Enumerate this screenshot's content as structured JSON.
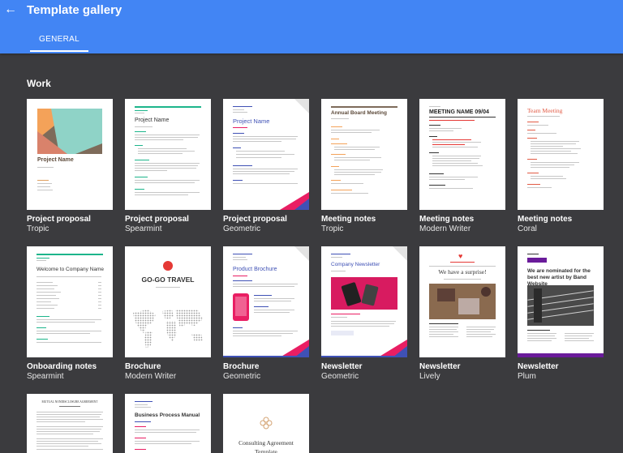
{
  "header": {
    "back_icon": "arrow-left-icon",
    "title": "Template gallery",
    "tab": "GENERAL",
    "accent": "#4285f4"
  },
  "section": {
    "title": "Work"
  },
  "templates": [
    {
      "name": "Project proposal",
      "style": "Tropic",
      "thumb_title": "Project Name"
    },
    {
      "name": "Project proposal",
      "style": "Spearmint",
      "thumb_title": "Project Name"
    },
    {
      "name": "Project proposal",
      "style": "Geometric",
      "thumb_title": "Project Name"
    },
    {
      "name": "Meeting notes",
      "style": "Tropic",
      "thumb_title": "Annual Board Meeting"
    },
    {
      "name": "Meeting notes",
      "style": "Modern Writer",
      "thumb_title": "MEETING NAME 09/04"
    },
    {
      "name": "Meeting notes",
      "style": "Coral",
      "thumb_title": "Team Meeting"
    },
    {
      "name": "Onboarding notes",
      "style": "Spearmint",
      "thumb_title": "Welcome to Company Name"
    },
    {
      "name": "Brochure",
      "style": "Modern Writer",
      "thumb_title": "GO-GO TRAVEL"
    },
    {
      "name": "Brochure",
      "style": "Geometric",
      "thumb_title": "Product Brochure"
    },
    {
      "name": "Newsletter",
      "style": "Geometric",
      "thumb_title": "Company Newsletter"
    },
    {
      "name": "Newsletter",
      "style": "Lively",
      "thumb_title": "We have a surprise!"
    },
    {
      "name": "Newsletter",
      "style": "Plum",
      "thumb_title": "We are nominated for the best new artist by Band Website"
    },
    {
      "name": "",
      "style": "",
      "thumb_title": "MUTUAL NONDISCLOSURE AGREEMENT"
    },
    {
      "name": "",
      "style": "",
      "thumb_title": "Business Process Manual"
    },
    {
      "name": "",
      "style": "",
      "thumb_title": "Consulting Agreement Template"
    }
  ]
}
